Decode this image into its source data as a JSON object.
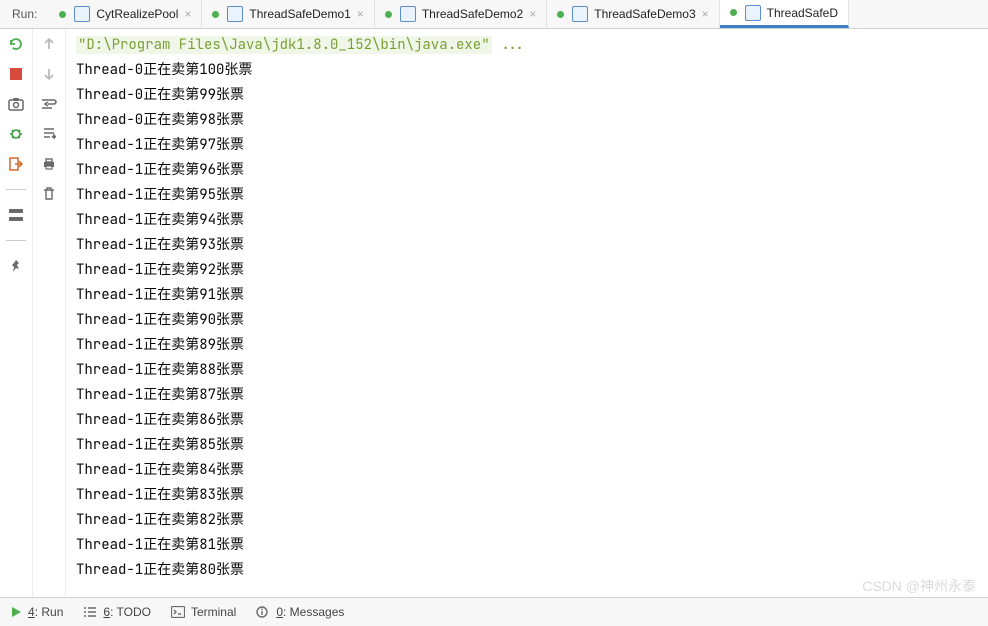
{
  "header": {
    "run_label": "Run:",
    "tabs": [
      {
        "label": "CytRealizePool",
        "active": false
      },
      {
        "label": "ThreadSafeDemo1",
        "active": false
      },
      {
        "label": "ThreadSafeDemo2",
        "active": false
      },
      {
        "label": "ThreadSafeDemo3",
        "active": false
      },
      {
        "label": "ThreadSafeD",
        "active": true
      }
    ]
  },
  "console": {
    "command_path": "\"D:\\Program Files\\Java\\jdk1.8.0_152\\bin\\java.exe\"",
    "command_dots": " ...",
    "lines": [
      "Thread-0正在卖第100张票",
      "Thread-0正在卖第99张票",
      "Thread-0正在卖第98张票",
      "Thread-1正在卖第97张票",
      "Thread-1正在卖第96张票",
      "Thread-1正在卖第95张票",
      "Thread-1正在卖第94张票",
      "Thread-1正在卖第93张票",
      "Thread-1正在卖第92张票",
      "Thread-1正在卖第91张票",
      "Thread-1正在卖第90张票",
      "Thread-1正在卖第89张票",
      "Thread-1正在卖第88张票",
      "Thread-1正在卖第87张票",
      "Thread-1正在卖第86张票",
      "Thread-1正在卖第85张票",
      "Thread-1正在卖第84张票",
      "Thread-1正在卖第83张票",
      "Thread-1正在卖第82张票",
      "Thread-1正在卖第81张票",
      "Thread-1正在卖第80张票"
    ]
  },
  "bottom": {
    "run_n": "4",
    "run_label": ": Run",
    "todo_n": "6",
    "todo_label": ": TODO",
    "terminal_label": "Terminal",
    "messages_n": "0",
    "messages_label": ": Messages"
  },
  "watermark": "CSDN @神州永泰"
}
